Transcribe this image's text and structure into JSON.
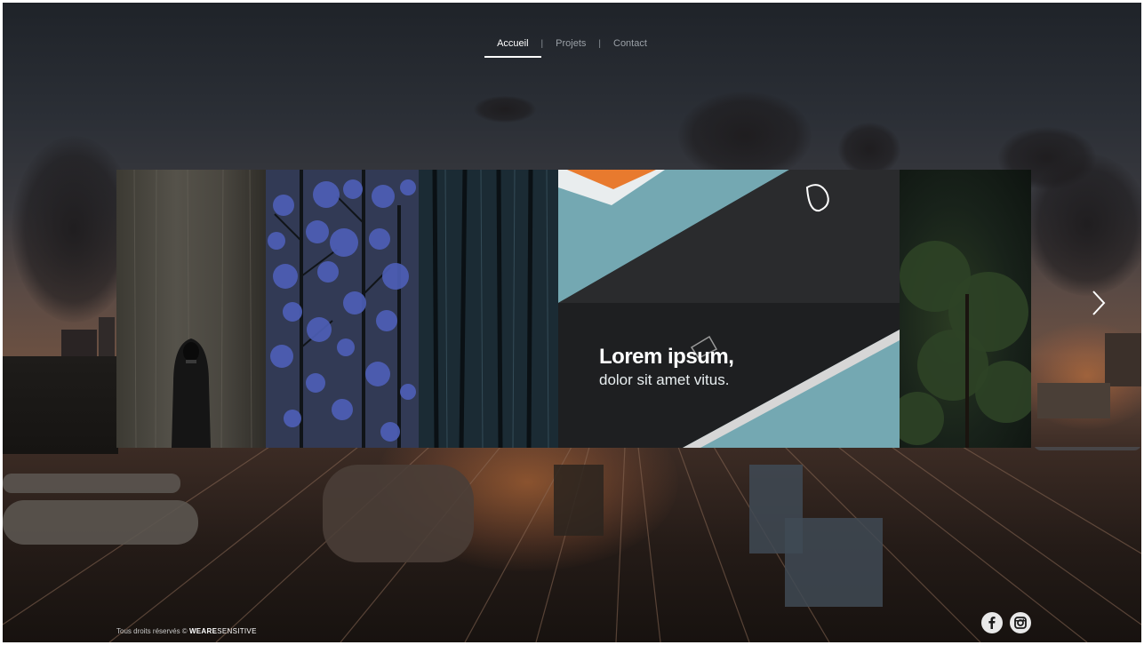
{
  "nav": {
    "items": [
      {
        "label": "Accueil",
        "active": true
      },
      {
        "label": "Projets",
        "active": false
      },
      {
        "label": "Contact",
        "active": false
      }
    ],
    "separator": "|"
  },
  "slider": {
    "caption_title": "Lorem ipsum,",
    "caption_subtitle": "dolor sit amet vitus.",
    "next_icon": "chevron-right-icon"
  },
  "footer": {
    "rights_text": "Tous droits réservés ©",
    "brand_prefix": "WEARE",
    "brand_suffix": "SENSITIVE"
  },
  "social": {
    "facebook_icon": "facebook-icon",
    "instagram_icon": "instagram-icon"
  },
  "colors": {
    "nav_active": "#ffffff",
    "nav_inactive": "#9aa0a6",
    "accent_orange": "#e87a2e"
  }
}
